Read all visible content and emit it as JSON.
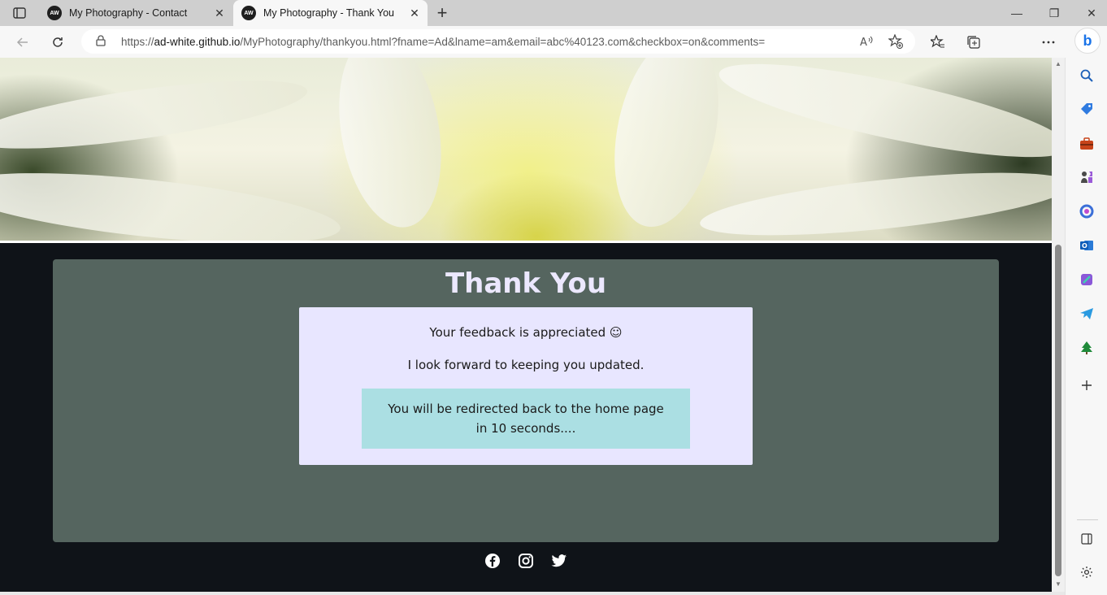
{
  "browser": {
    "tabs": [
      {
        "title": "My Photography - Contact",
        "favicon_text": "AW",
        "active": false
      },
      {
        "title": "My Photography - Thank You",
        "favicon_text": "AW",
        "active": true
      }
    ],
    "close_glyph": "✕",
    "new_tab_glyph": "+",
    "window_controls": {
      "minimize": "—",
      "maximize": "❐",
      "close": "✕"
    },
    "url": {
      "prefix": "https://",
      "host": "ad-white.github.io",
      "path": "/MyPhotography/thankyou.html?fname=Ad&lname=am&email=abc%40123.com&checkbox=on&comments="
    },
    "bing_label": "b"
  },
  "page": {
    "heading": "Thank You",
    "feedback_line": "Your feedback is appreciated ☺",
    "forward_line": "I look forward to keeping you updated.",
    "redirect_text": "You will be redirected back to the home page in 10 seconds...."
  },
  "social_icons": [
    "facebook-icon",
    "instagram-icon",
    "twitter-icon"
  ],
  "colors": {
    "page_bg": "#0f1318",
    "card_bg": "#55655f",
    "message_bg": "#e8e6ff",
    "redirect_bg": "#abdfe3",
    "heading_color": "#ece8ff"
  }
}
